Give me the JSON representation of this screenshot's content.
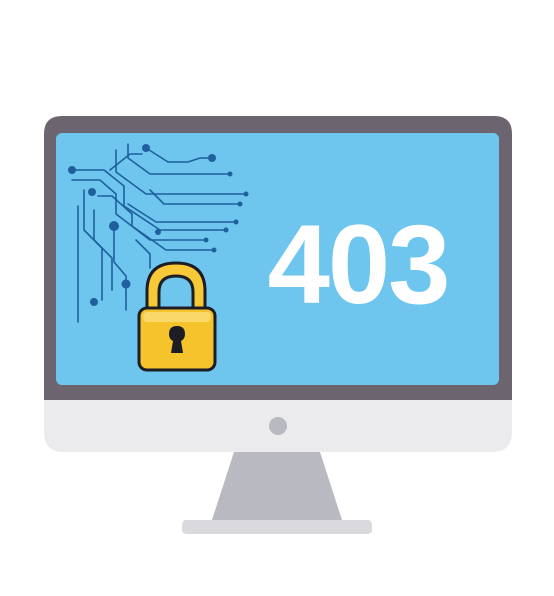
{
  "error_code": "403",
  "icons": {
    "monitor": "monitor-icon",
    "lock": "padlock-icon",
    "circuit": "circuit-lines-icon",
    "power": "power-dot-icon"
  },
  "colors": {
    "screen": "#6EC6EE",
    "bezel": "#6C6570",
    "chin": "#EBEBED",
    "stand": "#B9B9C1",
    "base": "#D9D9DE",
    "lock_body": "#F5C42C",
    "lock_shackle": "#F7C936",
    "outline": "#1D1D26",
    "circuit": "#1F5F9E",
    "text": "#FFFFFF"
  }
}
